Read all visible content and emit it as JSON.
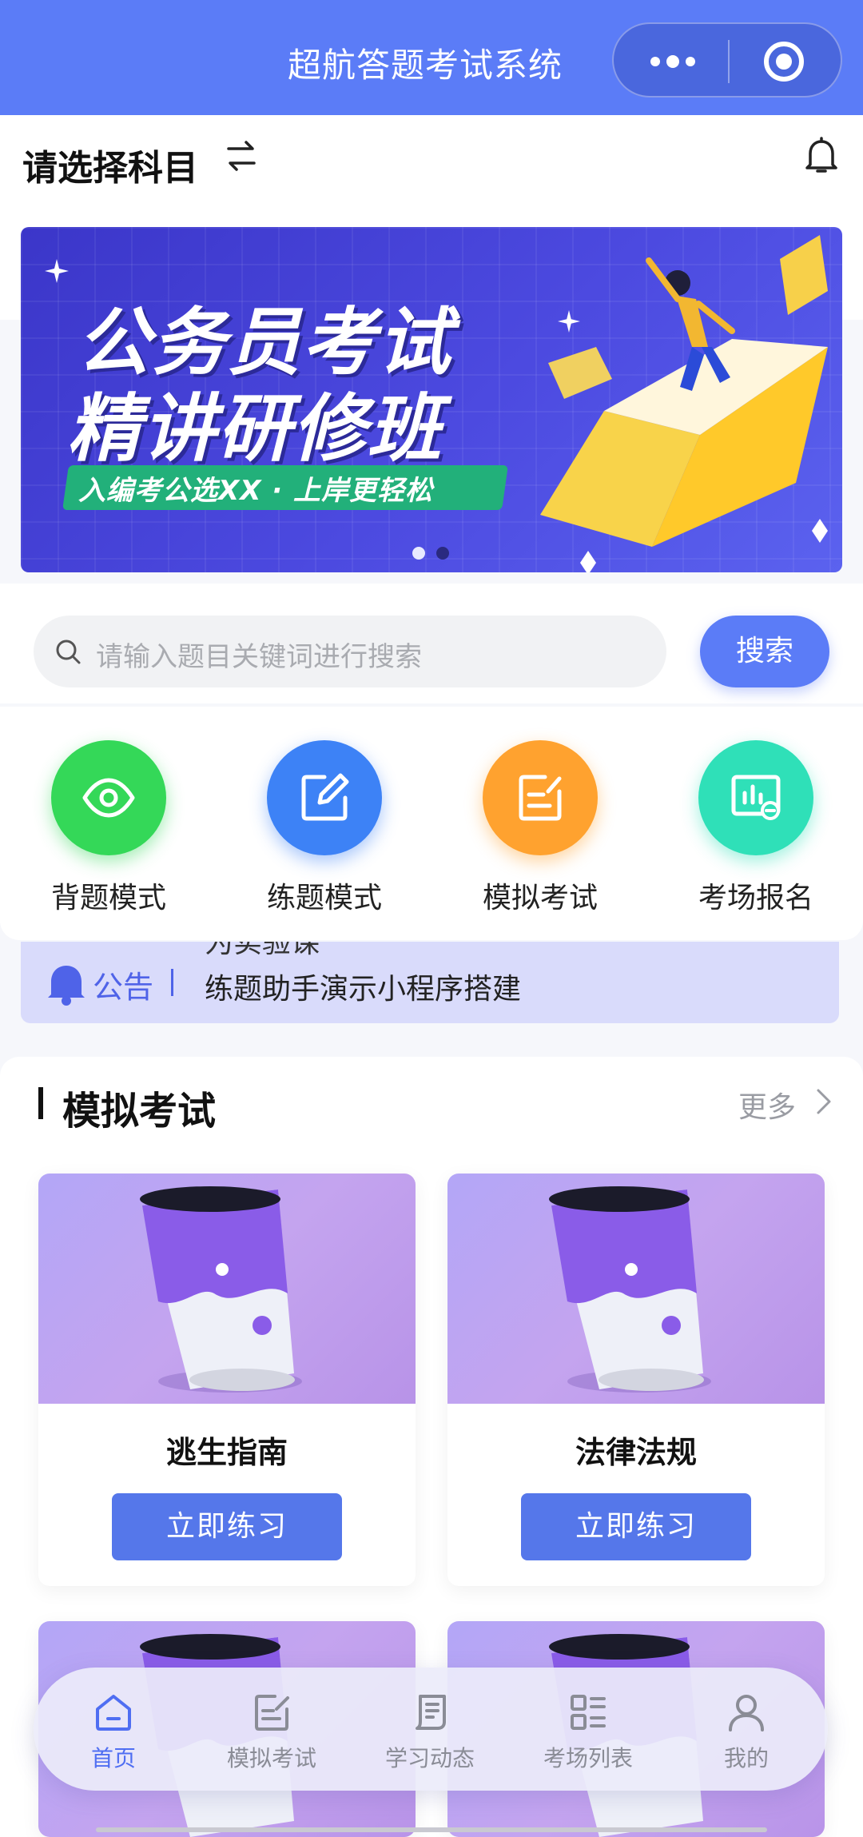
{
  "header": {
    "title": "超航答题考试系统",
    "menu_icon": "more-dots-icon",
    "close_icon": "target-icon"
  },
  "subject": {
    "title": "请选择科目",
    "swap_icon": "swap-arrows-icon",
    "bell_icon": "bell-icon"
  },
  "banner": {
    "line1": "公务员考试",
    "line2": "精讲研修班",
    "tag": "入编考公选XX · 上岸更轻松",
    "active_slide": 1,
    "slide_count": 2
  },
  "search": {
    "placeholder": "请输入题目关键词进行搜索",
    "button": "搜索"
  },
  "modes": [
    {
      "label": "背题模式",
      "icon": "eye-icon",
      "color": "#34d858"
    },
    {
      "label": "练题模式",
      "icon": "edit-icon",
      "color": "#3d82f6"
    },
    {
      "label": "模拟考试",
      "icon": "note-icon",
      "color": "#ffa22f"
    },
    {
      "label": "考场报名",
      "icon": "chart-board-icon",
      "color": "#2fe0b8"
    }
  ],
  "notice": {
    "label": "公告",
    "prev_text": "为实验课",
    "text": "练题助手演示小程序搭建"
  },
  "section": {
    "title": "模拟考试",
    "more": "更多",
    "cards": [
      {
        "title": "逃生指南",
        "button": "立即练习"
      },
      {
        "title": "法律法规",
        "button": "立即练习"
      },
      {
        "title": "",
        "button": ""
      },
      {
        "title": "",
        "button": ""
      }
    ]
  },
  "tabbar": [
    {
      "label": "首页",
      "icon": "home-icon",
      "active": true
    },
    {
      "label": "模拟考试",
      "icon": "exam-icon",
      "active": false
    },
    {
      "label": "学习动态",
      "icon": "news-icon",
      "active": false
    },
    {
      "label": "考场列表",
      "icon": "grid-list-icon",
      "active": false
    },
    {
      "label": "我的",
      "icon": "user-icon",
      "active": false
    }
  ],
  "colors": {
    "primary": "#5b7cf7",
    "accent_button": "#5577ea",
    "notice_bg": "#d9dbfb"
  }
}
